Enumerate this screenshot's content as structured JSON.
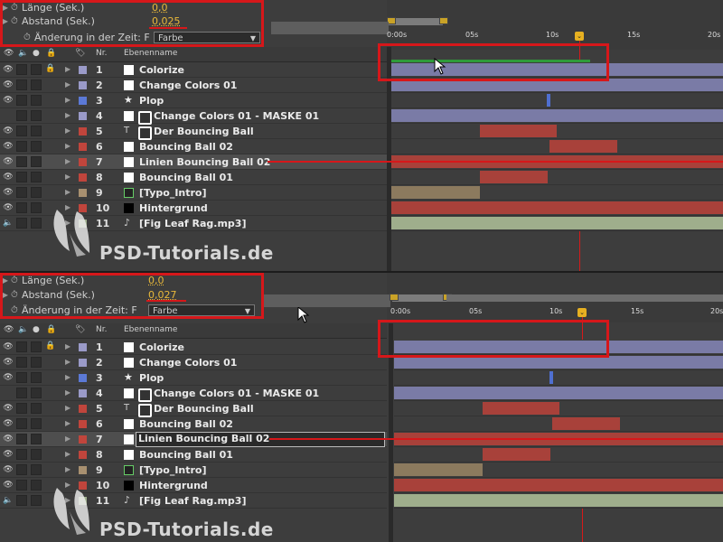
{
  "colors": {
    "red_annotation": "#d6171a",
    "purple_bar": "#7a7ba6",
    "red_bar": "#a8413a",
    "tan_bar": "#8c7a5e",
    "green_bar": "#9fae8c",
    "green_work": "#2f9b3a",
    "gold": "#e8b83a"
  },
  "panels": [
    {
      "props": [
        {
          "label": "Länge (Sek.)",
          "value": "0,0"
        },
        {
          "label": "Abstand (Sek.)",
          "value": "0,025"
        },
        {
          "label": "Änderung in der Zeit: F",
          "value": "Farbe"
        }
      ],
      "ruler": [
        "0:00s",
        "05s",
        "10s",
        "15s",
        "20s"
      ],
      "header": {
        "nr": "Nr.",
        "name": "Ebenenname"
      },
      "layers": [
        {
          "num": "1",
          "name": "Colorize",
          "chip": "#9a9ac8",
          "lock": true
        },
        {
          "num": "2",
          "name": "Change Colors 01",
          "chip": "#9a9ac8"
        },
        {
          "num": "3",
          "name": "Plop",
          "chip": "#5b79d6",
          "star": true
        },
        {
          "num": "4",
          "name": "Change Colors 01 - MASKE 01",
          "chip": "#9a9ac8",
          "mask": true
        },
        {
          "num": "5",
          "name": "Der Bouncing Ball",
          "chip": "#c0453c",
          "tcol": true
        },
        {
          "num": "6",
          "name": "Bouncing Ball 02",
          "chip": "#c0453c"
        },
        {
          "num": "7",
          "name": "Linien Bouncing Ball 02",
          "chip": "#c0453c"
        },
        {
          "num": "8",
          "name": "Bouncing Ball 01",
          "chip": "#c0453c"
        },
        {
          "num": "9",
          "name": "[Typo_Intro]",
          "chip": "#a89070"
        },
        {
          "num": "10",
          "name": "Hintergrund",
          "chip": "#c0453c"
        },
        {
          "num": "11",
          "name": "[Fig Leaf Rag.mp3]",
          "chip": "#a0b090"
        }
      ]
    },
    {
      "props": [
        {
          "label": "Länge (Sek.)",
          "value": "0,0"
        },
        {
          "label": "Abstand (Sek.)",
          "value": "0,027"
        },
        {
          "label": "Änderung in der Zeit: F",
          "value": "Farbe"
        }
      ],
      "ruler": [
        "0:00s",
        "05s",
        "10s",
        "15s",
        "20s"
      ],
      "header": {
        "nr": "Nr.",
        "name": "Ebenenname"
      },
      "layers": [
        {
          "num": "1",
          "name": "Colorize",
          "chip": "#9a9ac8",
          "lock": true
        },
        {
          "num": "2",
          "name": "Change Colors 01",
          "chip": "#9a9ac8"
        },
        {
          "num": "3",
          "name": "Plop",
          "chip": "#5b79d6",
          "star": true
        },
        {
          "num": "4",
          "name": "Change Colors 01 - MASKE 01",
          "chip": "#9a9ac8",
          "mask": true
        },
        {
          "num": "5",
          "name": "Der Bouncing Ball",
          "chip": "#c0453c",
          "tcol": true
        },
        {
          "num": "6",
          "name": "Bouncing Ball 02",
          "chip": "#c0453c"
        },
        {
          "num": "7",
          "name": "Linien Bouncing Ball 02",
          "chip": "#c0453c"
        },
        {
          "num": "8",
          "name": "Bouncing Ball 01",
          "chip": "#c0453c"
        },
        {
          "num": "9",
          "name": "[Typo_Intro]",
          "chip": "#a89070"
        },
        {
          "num": "10",
          "name": "Hintergrund",
          "chip": "#c0453c"
        },
        {
          "num": "11",
          "name": "[Fig Leaf Rag.mp3]",
          "chip": "#a0b090"
        }
      ]
    }
  ],
  "watermark": "PSD-Tutorials.de"
}
